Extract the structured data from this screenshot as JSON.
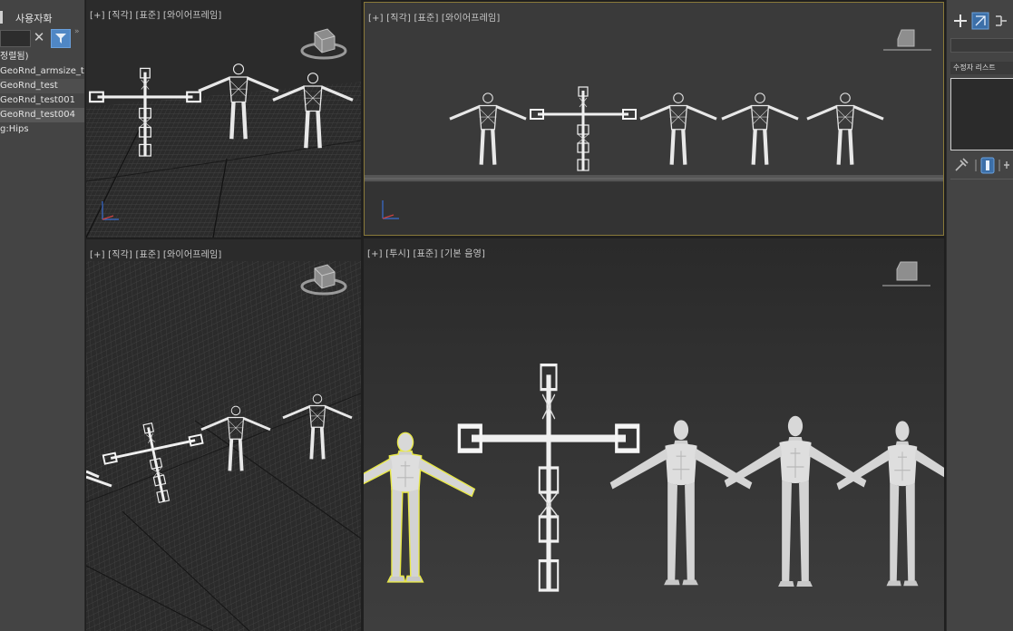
{
  "scene_explorer": {
    "header_label": "사용자화",
    "rows": [
      {
        "label": "정렬됨)"
      },
      {
        "label": "GeoRnd_armsize_t"
      },
      {
        "label": "GeoRnd_test"
      },
      {
        "label": "GeoRnd_test001"
      },
      {
        "label": "GeoRnd_test004"
      },
      {
        "label": "g:Hips"
      }
    ]
  },
  "viewports": {
    "top_left": {
      "title": "[+] [직각] [표준] [와이어프레임]"
    },
    "top_right": {
      "title": "[+] [직각] [표준] [와이어프레임]"
    },
    "bottom_left": {
      "title": "[+] [직각] [표준] [와이어프레임]"
    },
    "bottom_right": {
      "title": "[+] [투시] [표준] [기본 음영]"
    }
  },
  "command_panel": {
    "modifier_list_label": "수정자 리스트"
  },
  "colors": {
    "active_viewport_border": "#8a7a3a",
    "selection_outline": "#e8e84a",
    "filter_button": "#4f87c5"
  }
}
